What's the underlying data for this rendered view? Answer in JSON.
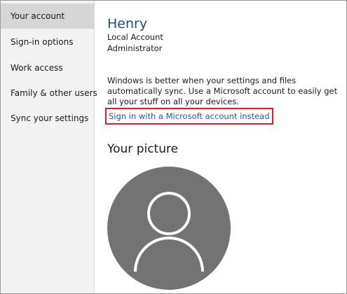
{
  "sidebar": {
    "items": [
      {
        "label": "Your account",
        "selected": true
      },
      {
        "label": "Sign-in options",
        "selected": false
      },
      {
        "label": "Work access",
        "selected": false
      },
      {
        "label": "Family & other users",
        "selected": false
      },
      {
        "label": "Sync your settings",
        "selected": false
      }
    ]
  },
  "account": {
    "name": "Henry",
    "type": "Local Account",
    "role": "Administrator",
    "description": "Windows is better when your settings and files automatically sync. Use a Microsoft account to easily get all your stuff on all your devices.",
    "link_label": "Sign in with a Microsoft account instead"
  },
  "picture": {
    "title": "Your picture",
    "avatar_icon": "default-user-icon",
    "avatar_bg": "#737373"
  },
  "colors": {
    "accent": "#1f4e79",
    "link": "#1e5aa8",
    "highlight_border": "#d21f2b"
  }
}
